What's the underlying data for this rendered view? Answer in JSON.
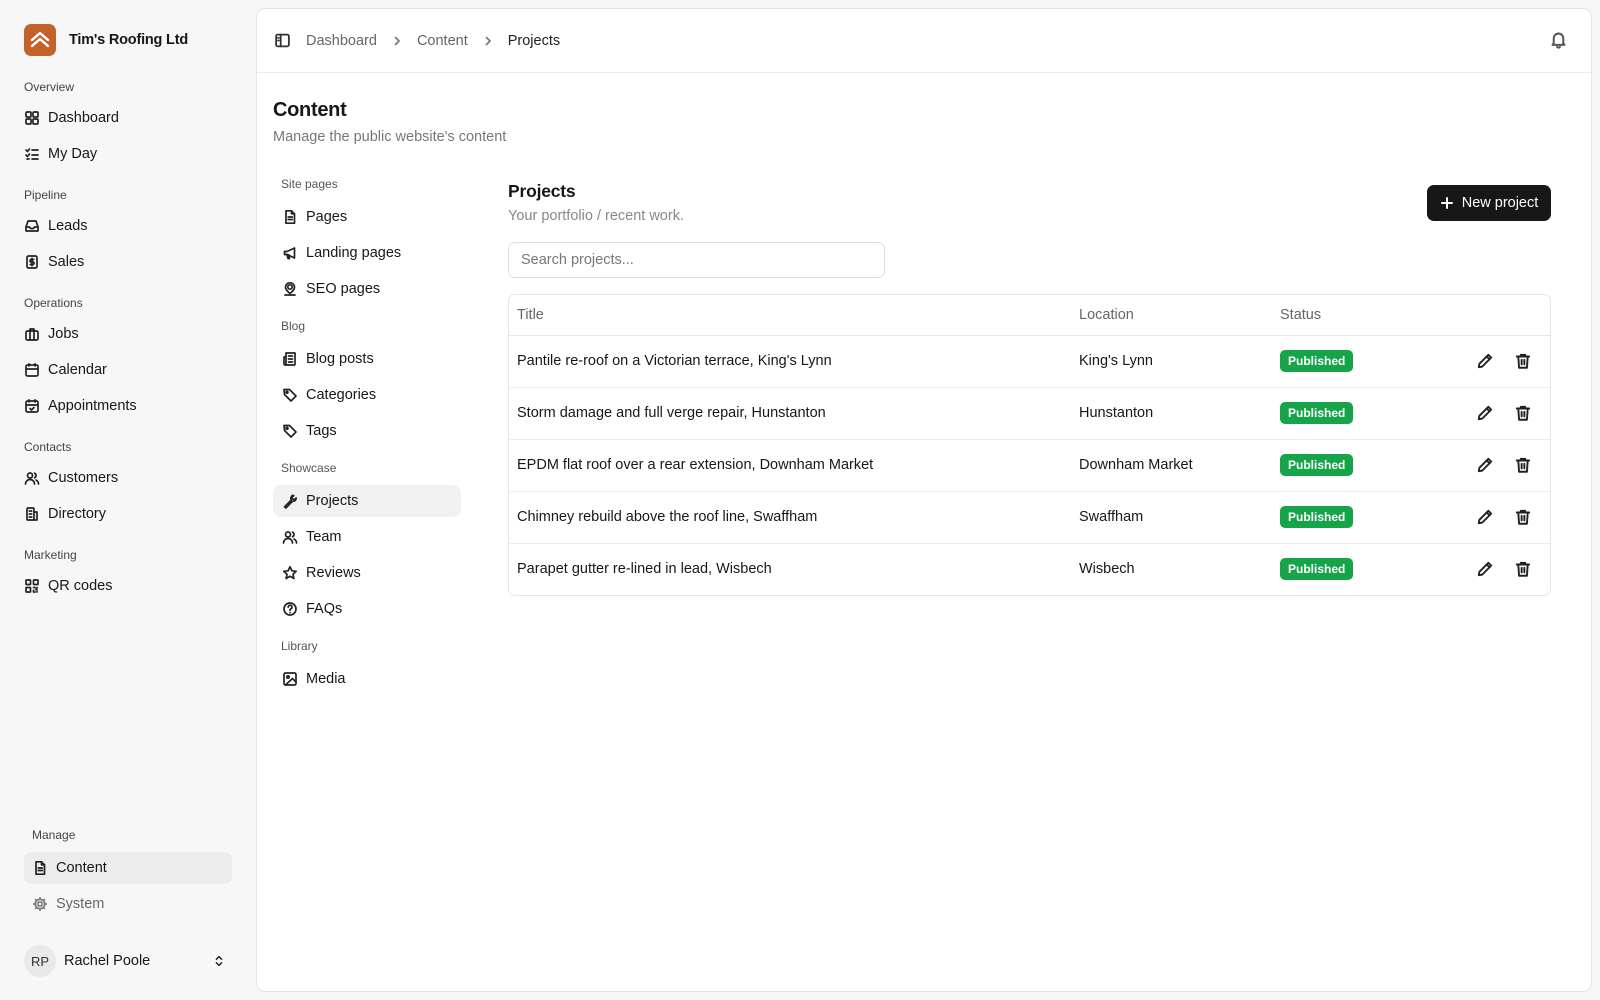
{
  "brand": {
    "name": "Tim's Roofing Ltd",
    "logo_color": "#c4622c"
  },
  "sidebar": {
    "sections": [
      {
        "label": "Overview",
        "items": [
          {
            "label": "Dashboard",
            "icon": "dashboard-grid-icon"
          },
          {
            "label": "My Day",
            "icon": "list-check-icon"
          }
        ]
      },
      {
        "label": "Pipeline",
        "items": [
          {
            "label": "Leads",
            "icon": "inbox-icon"
          },
          {
            "label": "Sales",
            "icon": "dollar-receipt-icon"
          }
        ]
      },
      {
        "label": "Operations",
        "items": [
          {
            "label": "Jobs",
            "icon": "briefcase-icon"
          },
          {
            "label": "Calendar",
            "icon": "calendar-icon"
          },
          {
            "label": "Appointments",
            "icon": "calendar-check-icon"
          }
        ]
      },
      {
        "label": "Contacts",
        "items": [
          {
            "label": "Customers",
            "icon": "users-icon"
          },
          {
            "label": "Directory",
            "icon": "building-icon"
          }
        ]
      },
      {
        "label": "Marketing",
        "items": [
          {
            "label": "QR codes",
            "icon": "qr-code-icon"
          }
        ]
      }
    ],
    "manage": {
      "label": "Manage",
      "items": [
        {
          "label": "Content",
          "icon": "file-text-icon",
          "active": true
        },
        {
          "label": "System",
          "icon": "gear-icon",
          "active": false
        }
      ]
    },
    "user": {
      "initials": "RP",
      "name": "Rachel Poole"
    }
  },
  "breadcrumb": [
    "Dashboard",
    "Content",
    "Projects"
  ],
  "page": {
    "title": "Content",
    "subtitle": "Manage the public website's content"
  },
  "content_nav": {
    "sections": [
      {
        "label": "Site pages",
        "items": [
          {
            "label": "Pages",
            "icon": "file-text-icon"
          },
          {
            "label": "Landing pages",
            "icon": "megaphone-icon"
          },
          {
            "label": "SEO pages",
            "icon": "map-pin-user-icon"
          }
        ]
      },
      {
        "label": "Blog",
        "items": [
          {
            "label": "Blog posts",
            "icon": "newspaper-icon"
          },
          {
            "label": "Categories",
            "icon": "tag-icon"
          },
          {
            "label": "Tags",
            "icon": "tag-icon"
          }
        ]
      },
      {
        "label": "Showcase",
        "items": [
          {
            "label": "Projects",
            "icon": "wrench-icon",
            "active": true
          },
          {
            "label": "Team",
            "icon": "users-icon"
          },
          {
            "label": "Reviews",
            "icon": "star-icon"
          },
          {
            "label": "FAQs",
            "icon": "help-circle-icon"
          }
        ]
      },
      {
        "label": "Library",
        "items": [
          {
            "label": "Media",
            "icon": "image-icon"
          }
        ]
      }
    ]
  },
  "projects": {
    "title": "Projects",
    "subtitle": "Your portfolio / recent work.",
    "new_button": "New project",
    "search_placeholder": "Search projects...",
    "columns": [
      "Title",
      "Location",
      "Status"
    ],
    "rows": [
      {
        "title": "Pantile re-roof on a Victorian terrace, King's Lynn",
        "location": "King's Lynn",
        "status": "Published"
      },
      {
        "title": "Storm damage and full verge repair, Hunstanton",
        "location": "Hunstanton",
        "status": "Published"
      },
      {
        "title": "EPDM flat roof over a rear extension, Downham Market",
        "location": "Downham Market",
        "status": "Published"
      },
      {
        "title": "Chimney rebuild above the roof line, Swaffham",
        "location": "Swaffham",
        "status": "Published"
      },
      {
        "title": "Parapet gutter re-lined in lead, Wisbech",
        "location": "Wisbech",
        "status": "Published"
      }
    ],
    "status_color": "#16a34a"
  }
}
